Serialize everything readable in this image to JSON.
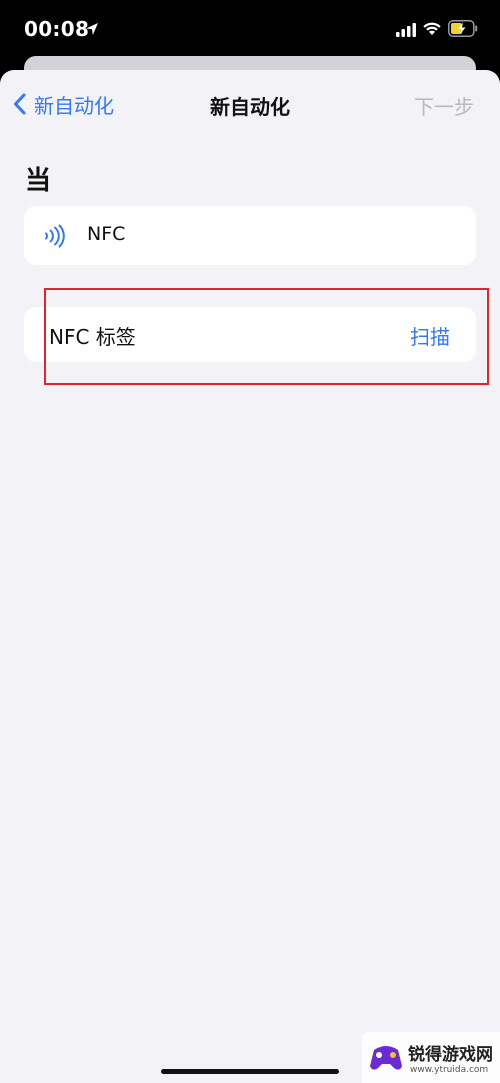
{
  "status_bar": {
    "time": "00:08",
    "icons": [
      "location-arrow-icon",
      "cellular-signal-icon",
      "wifi-icon",
      "battery-charging-icon"
    ]
  },
  "nav": {
    "back_label": "新自动化",
    "title": "新自动化",
    "next_label": "下一步"
  },
  "section": {
    "title": "当"
  },
  "trigger": {
    "icon": "nfc-icon",
    "label": "NFC"
  },
  "tag_row": {
    "label": "NFC 标签",
    "action_label": "扫描"
  },
  "watermark": {
    "name": "锐得游戏网",
    "url": "www.ytruida.com"
  },
  "colors": {
    "accent": "#3478f6",
    "disabled": "#b8b8bd",
    "background": "#f2f2f7",
    "highlight": "#e0262a"
  }
}
